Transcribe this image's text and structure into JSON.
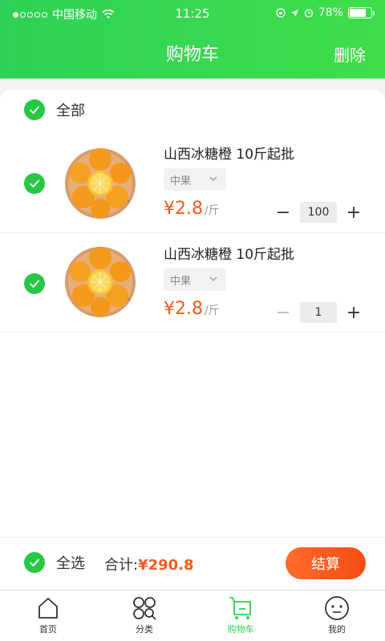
{
  "status_bar": {
    "carrier": "中国移动",
    "time": "11:25",
    "battery": "78%",
    "battery_level": 0.78
  },
  "header": {
    "title": "购物车",
    "delete_label": "删除"
  },
  "cart": {
    "all_label": "全部",
    "items": [
      {
        "name": "山西冰糖橙 10斤起批",
        "spec": "中果",
        "price": "¥2.8",
        "unit": "/斤",
        "minus": "−",
        "plus": "+",
        "quantity": "100"
      },
      {
        "name": "山西冰糖橙 10斤起批",
        "spec": "中果",
        "price": "¥2.8",
        "unit": "/斤",
        "minus": "−",
        "plus": "+",
        "quantity": "1"
      }
    ]
  },
  "bottom": {
    "select_all": "全选",
    "total_label": "合计:",
    "total_value": "¥290.8",
    "checkout": "结算"
  },
  "tabbar": {
    "tabs": [
      {
        "label": "首页",
        "icon": "home-icon"
      },
      {
        "label": "分类",
        "icon": "category-icon"
      },
      {
        "label": "购物车",
        "icon": "cart-icon"
      },
      {
        "label": "我的",
        "icon": "profile-icon"
      }
    ]
  },
  "colors": {
    "brand_green": "#2fd157",
    "price_orange": "#f25a1e"
  }
}
